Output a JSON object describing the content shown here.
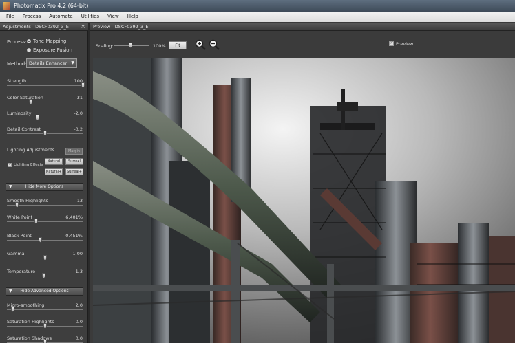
{
  "window": {
    "title": "Photomatix Pro 4.2 (64-bit)"
  },
  "menu": [
    "File",
    "Process",
    "Automate",
    "Utilities",
    "View",
    "Help"
  ],
  "adjustments_panel": {
    "title": "Adjustments - DSCF0392_3_E",
    "close": "×",
    "process_label": "Process:",
    "process_options": [
      {
        "label": "Tone Mapping",
        "selected": true
      },
      {
        "label": "Exposure Fusion",
        "selected": false
      }
    ],
    "method_label": "Method:",
    "method_value": "Details Enhancer",
    "sliders_main": [
      {
        "label": "Strength",
        "value": "100",
        "level": 1.0
      },
      {
        "label": "Color Saturation",
        "value": "31",
        "level": 0.31
      },
      {
        "label": "Luminosity",
        "value": "-2.0",
        "level": 0.4
      },
      {
        "label": "Detail Contrast",
        "value": "-0.2",
        "level": 0.5
      }
    ],
    "lighting_label": "Lighting Adjustments",
    "lighting_button": "Margin",
    "lighting_effects_label": "Lighting Effects",
    "lighting_buttons": [
      "Natural",
      "Surreal",
      "Natural+",
      "Surreal+"
    ],
    "more_options_bar": "Hide More Options",
    "sliders_more": [
      {
        "label": "Smooth Highlights",
        "value": "13",
        "level": 0.13
      },
      {
        "label": "White Point",
        "value": "6.401%",
        "level": 0.38
      },
      {
        "label": "Black Point",
        "value": "0.451%",
        "level": 0.44
      },
      {
        "label": "Gamma",
        "value": "1.00",
        "level": 0.5
      },
      {
        "label": "Temperature",
        "value": "-1.3",
        "level": 0.48
      }
    ],
    "advanced_bar": "Hide Advanced Options",
    "sliders_advanced": [
      {
        "label": "Micro-smoothing",
        "value": "2.0",
        "level": 0.07
      },
      {
        "label": "Saturation Highlights",
        "value": "0.0",
        "level": 0.5
      },
      {
        "label": "Saturation Shadows",
        "value": "0.0",
        "level": 0.5
      }
    ]
  },
  "preview_panel": {
    "title": "Preview - DSCF0392_3_E",
    "scaling_label": "Scaling:",
    "scaling_value": "100%",
    "fit_button": "Fit",
    "zoom_in_icon": "zoom-in-icon",
    "zoom_out_icon": "zoom-out-icon",
    "preview_label": "Preview",
    "preview_checked": true
  }
}
